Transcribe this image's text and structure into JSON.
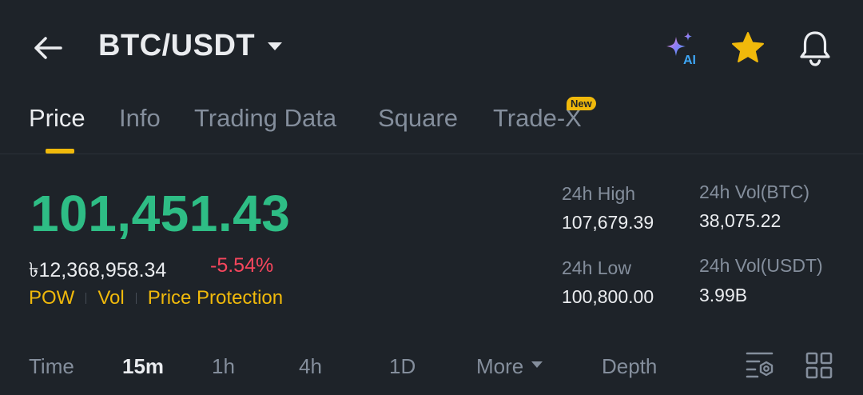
{
  "header": {
    "pair": "BTC/USDT",
    "icons": [
      "back-arrow-icon",
      "ai-sparkle-icon",
      "star-icon",
      "bell-icon"
    ],
    "ai_label": "AI"
  },
  "tabs": [
    {
      "label": "Price",
      "active": true
    },
    {
      "label": "Info"
    },
    {
      "label": "Trading Data"
    },
    {
      "label": "Square"
    },
    {
      "label": "Trade-X",
      "badge": "New"
    }
  ],
  "price": {
    "last": "101,451.43",
    "fiat": "৳12,368,958.34",
    "change": "-5.54%",
    "tags": [
      "POW",
      "Vol",
      "Price Protection"
    ]
  },
  "stats": {
    "high_label": "24h High",
    "high_value": "107,679.39",
    "low_label": "24h Low",
    "low_value": "100,800.00",
    "vol_base_label": "24h Vol(BTC)",
    "vol_base_value": "38,075.22",
    "vol_quote_label": "24h Vol(USDT)",
    "vol_quote_value": "3.99B"
  },
  "intervals": {
    "time": "Time",
    "m15": "15m",
    "h1": "1h",
    "h4": "4h",
    "d1": "1D",
    "more": "More",
    "depth": "Depth",
    "active": "15m"
  },
  "colors": {
    "background": "#1e2329",
    "up": "#2ebd85",
    "down": "#f6465d",
    "accent": "#f0b90b",
    "muted": "#848e9c",
    "text": "#eaecef"
  }
}
